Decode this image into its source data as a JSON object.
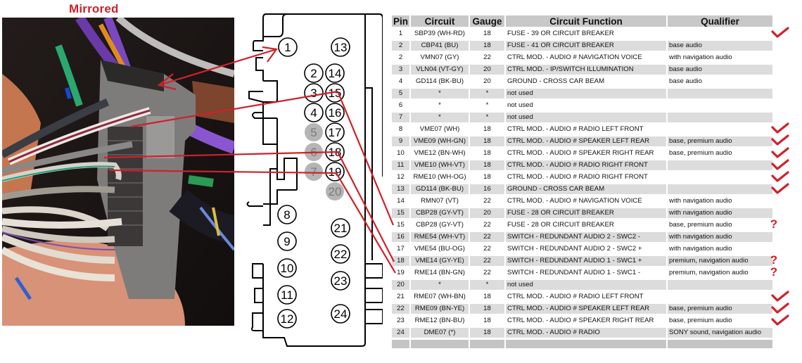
{
  "photo": {
    "title": "Mirrored"
  },
  "connector": {
    "pins_left": [
      {
        "num": "1",
        "used": true
      },
      {
        "num": "2",
        "used": true
      },
      {
        "num": "3",
        "used": true
      },
      {
        "num": "4",
        "used": true
      },
      {
        "num": "5",
        "used": false
      },
      {
        "num": "6",
        "used": false
      },
      {
        "num": "7",
        "used": false
      },
      {
        "num": "8",
        "used": true
      },
      {
        "num": "9",
        "used": true
      },
      {
        "num": "10",
        "used": true
      },
      {
        "num": "11",
        "used": true
      },
      {
        "num": "12",
        "used": true
      }
    ],
    "pins_right": [
      {
        "num": "13",
        "used": true
      },
      {
        "num": "14",
        "used": true
      },
      {
        "num": "15",
        "used": true
      },
      {
        "num": "16",
        "used": true
      },
      {
        "num": "17",
        "used": true
      },
      {
        "num": "18",
        "used": true
      },
      {
        "num": "19",
        "used": true
      },
      {
        "num": "20",
        "used": false
      },
      {
        "num": "21",
        "used": true
      },
      {
        "num": "22",
        "used": true
      },
      {
        "num": "23",
        "used": true
      },
      {
        "num": "24",
        "used": true
      }
    ]
  },
  "table": {
    "headers": {
      "pin": "Pin",
      "circuit": "Circuit",
      "gauge": "Gauge",
      "function": "Circuit Function",
      "qualifier": "Qualifier"
    },
    "rows": [
      {
        "pin": "1",
        "circuit": "SBP39 (WH-RD)",
        "gauge": "18",
        "function": "FUSE - 39 OR CIRCUIT BREAKER",
        "qualifier": "",
        "mark": "check"
      },
      {
        "pin": "2",
        "circuit": "CBP41 (BU)",
        "gauge": "18",
        "function": "FUSE - 41 OR CIRCUIT BREAKER",
        "qualifier": "base audio",
        "mark": ""
      },
      {
        "pin": "2",
        "circuit": "VMN07 (GY)",
        "gauge": "22",
        "function": "CTRL MOD. - AUDIO # NAVIGATION VOICE",
        "qualifier": "with navigation audio",
        "mark": ""
      },
      {
        "pin": "3",
        "circuit": "VLN04 (VT-GY)",
        "gauge": "20",
        "function": "CTRL MOD. - IP/SWITCH ILLUMINATION",
        "qualifier": "base audio",
        "mark": ""
      },
      {
        "pin": "4",
        "circuit": "GD114 (BK-BU)",
        "gauge": "20",
        "function": "GROUND - CROSS CAR BEAM",
        "qualifier": "base audio",
        "mark": ""
      },
      {
        "pin": "5",
        "circuit": "*",
        "gauge": "*",
        "function": "not used",
        "qualifier": "",
        "mark": ""
      },
      {
        "pin": "6",
        "circuit": "*",
        "gauge": "*",
        "function": "not used",
        "qualifier": "",
        "mark": ""
      },
      {
        "pin": "7",
        "circuit": "*",
        "gauge": "*",
        "function": "not used",
        "qualifier": "",
        "mark": ""
      },
      {
        "pin": "8",
        "circuit": "VME07 (WH)",
        "gauge": "18",
        "function": "CTRL MOD. - AUDIO # RADIO LEFT FRONT",
        "qualifier": "",
        "mark": "check"
      },
      {
        "pin": "9",
        "circuit": "VME09 (WH-GN)",
        "gauge": "18",
        "function": "CTRL MOD. - AUDIO # SPEAKER LEFT REAR",
        "qualifier": "base, premium audio",
        "mark": "check"
      },
      {
        "pin": "10",
        "circuit": "VME12 (BN-WH)",
        "gauge": "18",
        "function": "CTRL MOD. - AUDIO # SPEAKER RIGHT REAR",
        "qualifier": "base, premium audio",
        "mark": "check"
      },
      {
        "pin": "11",
        "circuit": "VME10 (WH-VT)",
        "gauge": "18",
        "function": "CTRL MOD. - AUDIO # RADIO RIGHT FRONT",
        "qualifier": "",
        "mark": "check"
      },
      {
        "pin": "12",
        "circuit": "RME10 (WH-OG)",
        "gauge": "18",
        "function": "CTRL MOD. - AUDIO # RADIO RIGHT FRONT",
        "qualifier": "",
        "mark": "check"
      },
      {
        "pin": "13",
        "circuit": "GD114 (BK-BU)",
        "gauge": "16",
        "function": "GROUND - CROSS CAR BEAM",
        "qualifier": "",
        "mark": "check"
      },
      {
        "pin": "14",
        "circuit": "RMN07 (VT)",
        "gauge": "22",
        "function": "CTRL MOD. - AUDIO # NAVIGATION VOICE",
        "qualifier": "with navigation audio",
        "mark": ""
      },
      {
        "pin": "15",
        "circuit": "CBP28 (GY-VT)",
        "gauge": "20",
        "function": "FUSE - 28 OR CIRCUIT BREAKER",
        "qualifier": "with navigation audio",
        "mark": ""
      },
      {
        "pin": "15",
        "circuit": "CBP28 (GY-VT)",
        "gauge": "22",
        "function": "FUSE - 28 OR CIRCUIT BREAKER",
        "qualifier": "base, premium audio",
        "mark": "question"
      },
      {
        "pin": "16",
        "circuit": "RME54 (WH-VT)",
        "gauge": "22",
        "function": "SWITCH - REDUNDANT AUDIO 2 - SWC2 -",
        "qualifier": "with navigation audio",
        "mark": ""
      },
      {
        "pin": "17",
        "circuit": "VME54 (BU-OG)",
        "gauge": "22",
        "function": "SWITCH - REDUNDANT AUDIO 2 - SWC2 +",
        "qualifier": "with navigation audio",
        "mark": ""
      },
      {
        "pin": "18",
        "circuit": "VME14 (GY-YE)",
        "gauge": "22",
        "function": "SWITCH - REDUNDANT AUDIO 1 - SWC1 +",
        "qualifier": "premium, navigation audio",
        "mark": "question"
      },
      {
        "pin": "19",
        "circuit": "RME14 (BN-GN)",
        "gauge": "22",
        "function": "SWITCH - REDUNDANT AUDIO 1 - SWC1 -",
        "qualifier": "premium, navigation audio",
        "mark": "question"
      },
      {
        "pin": "20",
        "circuit": "*",
        "gauge": "*",
        "function": "not used",
        "qualifier": "",
        "mark": ""
      },
      {
        "pin": "21",
        "circuit": "RME07 (WH-BN)",
        "gauge": "18",
        "function": "CTRL MOD. - AUDIO # RADIO LEFT FRONT",
        "qualifier": "",
        "mark": "check"
      },
      {
        "pin": "22",
        "circuit": "RME09 (BN-YE)",
        "gauge": "18",
        "function": "CTRL MOD. - AUDIO # SPEAKER LEFT REAR",
        "qualifier": "base, premium audio",
        "mark": "check"
      },
      {
        "pin": "23",
        "circuit": "RME12 (BN-BU)",
        "gauge": "18",
        "function": "CTRL MOD. - AUDIO # SPEAKER RIGHT REAR",
        "qualifier": "base, premium audio",
        "mark": "check"
      },
      {
        "pin": "24",
        "circuit": "DME07 (*)",
        "gauge": "18",
        "function": "CTRL MOD. - AUDIO # RADIO",
        "qualifier": "SONY sound, navigation audio",
        "mark": ""
      }
    ]
  },
  "markers": {
    "question_glyph": "?",
    "accent_color": "#d0202a"
  }
}
